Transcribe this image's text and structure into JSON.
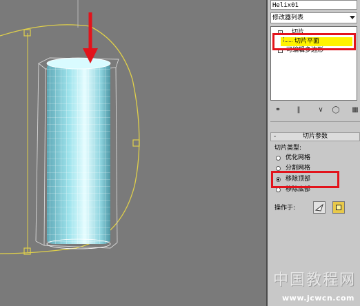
{
  "command_panel": {
    "object_name": "Helix01",
    "modifier_list_label": "修改器列表",
    "stack": {
      "slice_label": "切片",
      "slice_plane_label": "切片平面",
      "edit_poly_label": "可编辑多边形"
    },
    "slice_rollout": {
      "title": "切片参数",
      "collapse_symbol": "-",
      "type_label": "切片类型:",
      "options": [
        {
          "label": "优化网格",
          "selected": false
        },
        {
          "label": "分割网格",
          "selected": false
        },
        {
          "label": "移除顶部",
          "selected": true
        },
        {
          "label": "移除底部",
          "selected": false
        }
      ],
      "operate_on_label": "操作于:"
    }
  },
  "watermark": {
    "text": "中国教程网",
    "url": "www.jcwcn.com"
  },
  "colors": {
    "highlight": "#fff200",
    "annotation_red": "#e2131b",
    "gizmo_yellow": "#e0d04a",
    "cylinder_cyan": "#bff2f6"
  }
}
